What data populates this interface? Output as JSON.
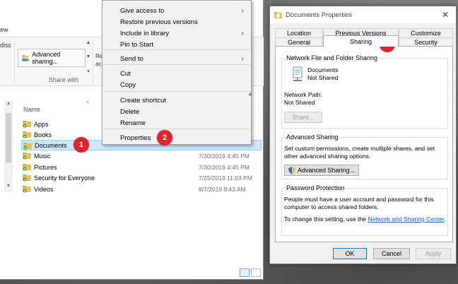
{
  "explorer": {
    "tab_fragment": "ew",
    "ribbon_left_fragment": "disc",
    "advanced_sharing_button": "Advanced sharing...",
    "ribbon_right_fragments": [
      "Re",
      "ac"
    ],
    "group_label": "Share with",
    "column_name": "Name",
    "files": [
      {
        "name": "Apps",
        "date": "",
        "icon": "folder-icon",
        "selected": false
      },
      {
        "name": "Books",
        "date": "",
        "icon": "folder-icon",
        "selected": false
      },
      {
        "name": "Documents",
        "date": "",
        "icon": "documents-folder-icon",
        "selected": true
      },
      {
        "name": "Music",
        "date": "7/30/2019 4:45 PM",
        "icon": "music-folder-icon",
        "selected": false
      },
      {
        "name": "Pictures",
        "date": "7/30/2019 4:45 PM",
        "icon": "pictures-folder-icon",
        "selected": false
      },
      {
        "name": "Security for Everyone",
        "date": "7/25/2019 11:03 PM",
        "icon": "folder-icon",
        "selected": false
      },
      {
        "name": "Videos",
        "date": "8/7/2019 9:43 AM",
        "icon": "videos-folder-icon",
        "selected": false
      }
    ]
  },
  "context_menu": {
    "group1": [
      {
        "label": "Give access to",
        "submenu": true
      },
      {
        "label": "Restore previous versions",
        "submenu": false
      },
      {
        "label": "Include in library",
        "submenu": true
      },
      {
        "label": "Pin to Start",
        "submenu": false
      }
    ],
    "group2": [
      {
        "label": "Send to",
        "submenu": true
      }
    ],
    "group3": [
      {
        "label": "Cut",
        "submenu": false
      },
      {
        "label": "Copy",
        "submenu": false
      }
    ],
    "group4": [
      {
        "label": "Create shortcut",
        "submenu": false
      },
      {
        "label": "Delete",
        "submenu": false
      },
      {
        "label": "Rename",
        "submenu": false
      }
    ],
    "group5": [
      {
        "label": "Properties",
        "submenu": false
      }
    ]
  },
  "badges": [
    "1",
    "2",
    "3"
  ],
  "dialog": {
    "title": "Documents Properties",
    "tabs_row1": [
      "Location",
      "Previous Versions",
      "Customize"
    ],
    "tabs_row2": [
      "General",
      "Sharing",
      "Security"
    ],
    "active_tab": "Sharing",
    "network": {
      "group_title": "Network File and Folder Sharing",
      "folder_name": "Documents",
      "folder_status": "Not Shared",
      "path_label": "Network Path:",
      "path_value": "Not Shared",
      "share_button": "Share..."
    },
    "advanced": {
      "group_title": "Advanced Sharing",
      "description": "Set custom permissions, create multiple shares, and set other advanced sharing options.",
      "button": "Advanced Sharing..."
    },
    "password": {
      "group_title": "Password Protection",
      "description": "People must have a user account and password for this computer to access shared folders.",
      "change_prefix": "To change this setting, use the",
      "link": "Network and Sharing Center",
      "change_suffix": "."
    },
    "buttons": {
      "ok": "OK",
      "cancel": "Cancel",
      "apply": "Apply"
    }
  },
  "colors": {
    "badge": "#e0242a",
    "selection": "#cce8ff",
    "link": "#0066cc"
  }
}
